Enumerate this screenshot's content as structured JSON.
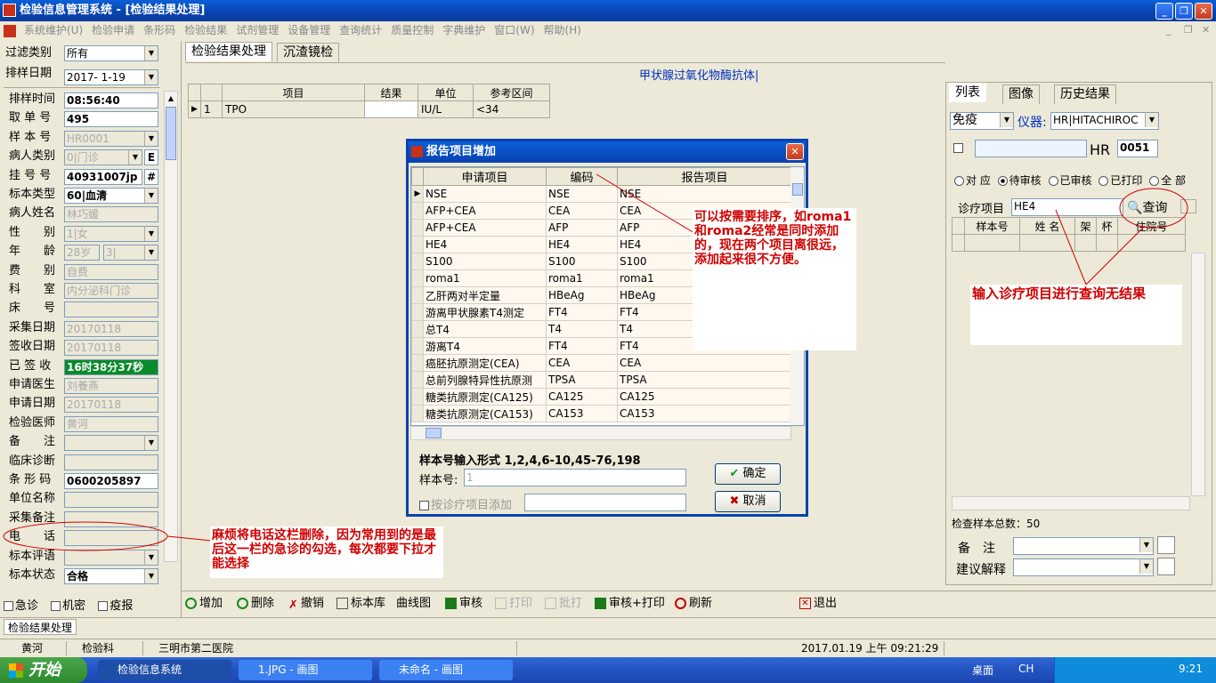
{
  "window": {
    "title": "检验信息管理系统 - [检验结果处理]"
  },
  "menu": [
    "系统维护(U)",
    "检验申请",
    "条形码",
    "检验结果",
    "试剂管理",
    "设备管理",
    "查询统计",
    "质量控制",
    "字典维护",
    "窗口(W)",
    "帮助(H)"
  ],
  "left": {
    "filter_label": "过滤类别",
    "filter_value": "所有",
    "date_label": "排样日期",
    "date_value": "2017- 1-19",
    "rows": [
      {
        "label": "排样时间",
        "value": "08:56:40",
        "style": "w"
      },
      {
        "label": "取 单 号",
        "value": "495",
        "style": "w"
      },
      {
        "label": "样 本 号",
        "value": "HR0001",
        "style": "g",
        "dd": true
      },
      {
        "label": "病人类别",
        "value": "0|门诊",
        "style": "g",
        "dd": true,
        "extra": "E"
      },
      {
        "label": "挂 号 号",
        "value": "40931007jp",
        "style": "w",
        "extra": "#"
      },
      {
        "label": "标本类型",
        "value": "60|血清",
        "style": "w",
        "dd": true
      },
      {
        "label": "病人姓名",
        "value": "林巧媛",
        "style": "g"
      },
      {
        "label": "性　　别",
        "value": "1|女",
        "style": "g",
        "dd": true
      },
      {
        "label": "年　　龄",
        "value": "28岁",
        "style": "g",
        "age2": "3|"
      },
      {
        "label": "费　　别",
        "value": "自费",
        "style": "g"
      },
      {
        "label": "科　　室",
        "value": "内分泌科门诊",
        "style": "g"
      },
      {
        "label": "床　　号",
        "value": "",
        "style": "g"
      },
      {
        "label": "采集日期",
        "value": "20170118",
        "style": "g"
      },
      {
        "label": "签收日期",
        "value": "20170118",
        "style": "g"
      },
      {
        "label": "已 签 收",
        "value": "16时38分37秒",
        "style": "green"
      },
      {
        "label": "申请医生",
        "value": "刘養燕",
        "style": "g"
      },
      {
        "label": "申请日期",
        "value": "20170118",
        "style": "g"
      },
      {
        "label": "检验医师",
        "value": "黄河",
        "style": "g"
      },
      {
        "label": "备　　注",
        "value": "",
        "style": "g",
        "dd": true
      },
      {
        "label": "临床诊断",
        "value": "",
        "style": "g"
      },
      {
        "label": "条 形 码",
        "value": "0600205897",
        "style": "w"
      },
      {
        "label": "单位名称",
        "value": "",
        "style": "g"
      },
      {
        "label": "采集备注",
        "value": "",
        "style": "g"
      },
      {
        "label": "电　　话",
        "value": "",
        "style": "g"
      },
      {
        "label": "标本评语",
        "value": "",
        "style": "g",
        "dd": true
      },
      {
        "label": "标本状态",
        "value": "合格",
        "style": "w",
        "dd": true
      }
    ],
    "checks": [
      "急诊",
      "机密",
      "疫报"
    ]
  },
  "main": {
    "tabs": [
      "检验结果处理",
      "沉渣镜检"
    ],
    "header_caption": "甲状腺过氧化物酶抗体|",
    "grid_headers": [
      "项目",
      "结果",
      "单位",
      "参考区间"
    ],
    "grid_rows": [
      {
        "no": "1",
        "item": "TPO",
        "result": "",
        "unit": "IU/L",
        "range": "<34"
      }
    ]
  },
  "dialog": {
    "title": "报告项目增加",
    "headers": [
      "申请项目",
      "编码",
      "报告项目"
    ],
    "rows": [
      [
        "NSE",
        "NSE",
        "NSE"
      ],
      [
        "AFP+CEA",
        "CEA",
        "CEA"
      ],
      [
        "AFP+CEA",
        "AFP",
        "AFP"
      ],
      [
        "HE4",
        "HE4",
        "HE4"
      ],
      [
        "S100",
        "S100",
        "S100"
      ],
      [
        "roma1",
        "roma1",
        "roma1"
      ],
      [
        "乙肝两对半定量",
        "HBeAg",
        "HBeAg"
      ],
      [
        "游离甲状腺素T4测定",
        "FT4",
        "FT4"
      ],
      [
        "总T4",
        "T4",
        "T4"
      ],
      [
        "游离T4",
        "FT4",
        "FT4"
      ],
      [
        "癌胚抗原测定(CEA)",
        "CEA",
        "CEA"
      ],
      [
        "总前列腺特异性抗原测",
        "TPSA",
        "TPSA"
      ],
      [
        "糖类抗原测定(CA125)",
        "CA125",
        "CA125"
      ],
      [
        "糖类抗原测定(CA153)",
        "CA153",
        "CA153"
      ]
    ],
    "format_label": "样本号输入形式 1,2,4,6-10,45-76,198",
    "sample_label": "样本号:",
    "sample_value": "1",
    "by_item_label": "按诊疗项目添加",
    "ok": "确定",
    "cancel": "取消"
  },
  "annotations": {
    "sort_note": "可以按需要排序，如roma1和roma2经常是同时添加的，现在两个项目离很远，添加起来很不方便。",
    "phone_note": "麻烦将电话这栏删除，因为常用到的是最后这一栏的急诊的勾选，每次都要下拉才能选择",
    "query_note": "输入诊疗项目进行查询无结果"
  },
  "right": {
    "tabs": [
      "列表",
      "图像",
      "历史结果"
    ],
    "dept_value": "免疫",
    "instrument_label": "仪器:",
    "instrument_value": "HR|HITACHIROC",
    "prefix": "HR",
    "number": "0051",
    "radios": [
      "对 应",
      "待审核",
      "已审核",
      "已打印",
      "全 部"
    ],
    "query_label": "诊疗项目",
    "query_value": "HE4",
    "query_btn": "查询",
    "list_headers": [
      "样本号",
      "姓 名",
      "架",
      "杯",
      "住院号"
    ],
    "total": "检查样本总数：50",
    "remark_label": "备　注",
    "suggest_label": "建议解释"
  },
  "toolbar": [
    "增加",
    "删除",
    "撤销",
    "标本库",
    "曲线图",
    "审核",
    "打印",
    "批打",
    "审核+打印",
    "刷新",
    "退出"
  ],
  "bottom_tab": "检验结果处理",
  "status": {
    "user": "黄河",
    "dept": "检验科",
    "hospital": "三明市第二医院",
    "datetime": "2017.01.19 上午 09:21:29"
  },
  "taskbar": {
    "start": "开始",
    "tasks": [
      "检验信息系统",
      "1.JPG - 画图",
      "未命名 - 画图"
    ],
    "desktop": "桌面",
    "lang": "CH",
    "clock": "9:21"
  },
  "colors": {
    "title_blue": "#0842b0",
    "note_red": "#d10000",
    "signed_green": "#0a8a2a"
  }
}
